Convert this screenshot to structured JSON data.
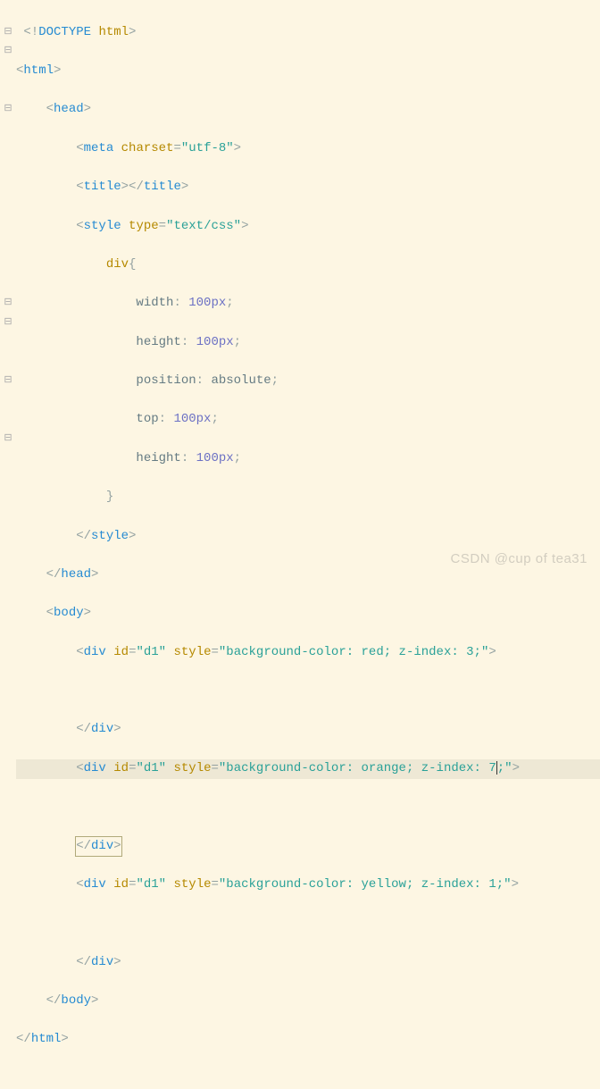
{
  "gutter_marks": [
    "",
    "⊟",
    "⊟",
    "",
    "",
    "⊟",
    "",
    "",
    "",
    "",
    "",
    "",
    "",
    "",
    "",
    "⊟",
    "⊟",
    "",
    "",
    "⊟",
    "",
    "",
    "⊟",
    "",
    "",
    "",
    "",
    ""
  ],
  "lines": {
    "l1": "<!DOCTYPE html>",
    "l2": "<html>",
    "l3": "<head>",
    "l4_tag": "meta",
    "l4_attr": "charset",
    "l4_val": "\"utf-8\"",
    "l5": "title",
    "l6_tag": "style",
    "l6_attr": "type",
    "l6_val": "\"text/css\"",
    "l7_sel": "div",
    "l8_p": "width",
    "l8_v": "100px",
    "l9_p": "height",
    "l9_v": "100px",
    "l10_p": "position",
    "l10_v": "absolute",
    "l11_p": "top",
    "l11_v": "100px",
    "l12_p": "height",
    "l12_v": "100px",
    "l14_close": "style",
    "l15_close": "head",
    "l16": "body",
    "div_tag": "div",
    "id_attr": "id",
    "id_val": "\"d1\"",
    "style_attr": "style",
    "d1_style": "\"background-color: red; z-index: 3;\"",
    "d2_style_a": "\"background-color: orange; z-index: ",
    "d2_style_b": "7",
    "d2_style_c": ";\"",
    "d3_style": "\"background-color: yellow; z-index: 1;\"",
    "div_close": "div",
    "body_close": "body",
    "html_close": "html"
  },
  "watermark": "CSDN @cup of tea31"
}
